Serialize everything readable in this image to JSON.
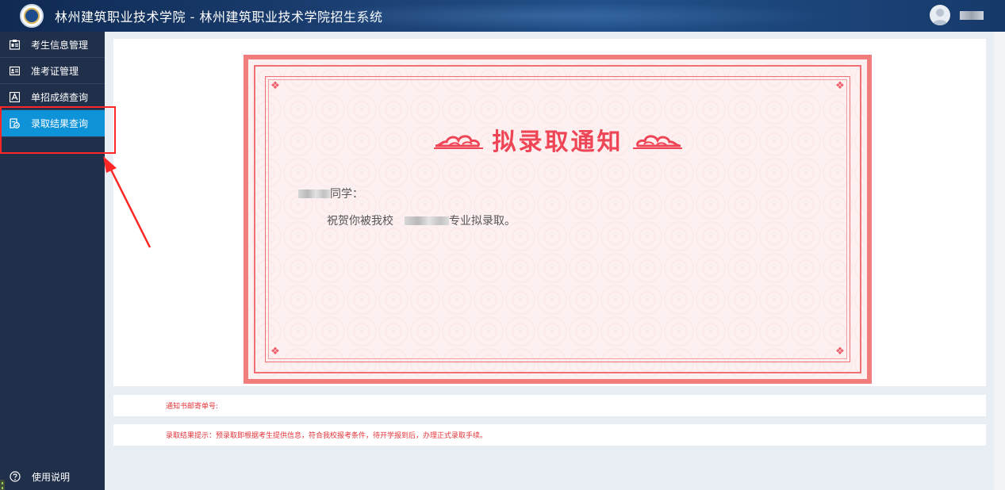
{
  "header": {
    "title": "林州建筑职业技术学院 - 林州建筑职业技术学院招生系统"
  },
  "sidebar": {
    "items": [
      {
        "label": "考生信息管理",
        "icon": "id-card-icon",
        "active": false
      },
      {
        "label": "准考证管理",
        "icon": "ticket-card-icon",
        "active": false
      },
      {
        "label": "单招成绩查询",
        "icon": "score-icon",
        "active": false
      },
      {
        "label": "录取结果查询",
        "icon": "admission-result-icon",
        "active": true
      }
    ],
    "help_label": "使用说明"
  },
  "certificate": {
    "title": "拟录取通知",
    "greeting_suffix": "同学：",
    "body_prefix": "祝贺你被我校",
    "body_suffix": "专业拟录取。"
  },
  "info": {
    "mail_label": "通知书邮寄单号:",
    "tip": "录取结果提示：预录取即根据考生提供信息，符合我校报考条件，待开学报到后，办理正式录取手续。"
  },
  "colors": {
    "header_bg": "#1b3f72",
    "sidebar_bg": "#21304a",
    "active_item": "#0f93d8",
    "certificate_border": "#f27d7d",
    "certificate_title": "#ee4656",
    "tip_text": "#e3353b",
    "annotation": "#ff2626"
  }
}
